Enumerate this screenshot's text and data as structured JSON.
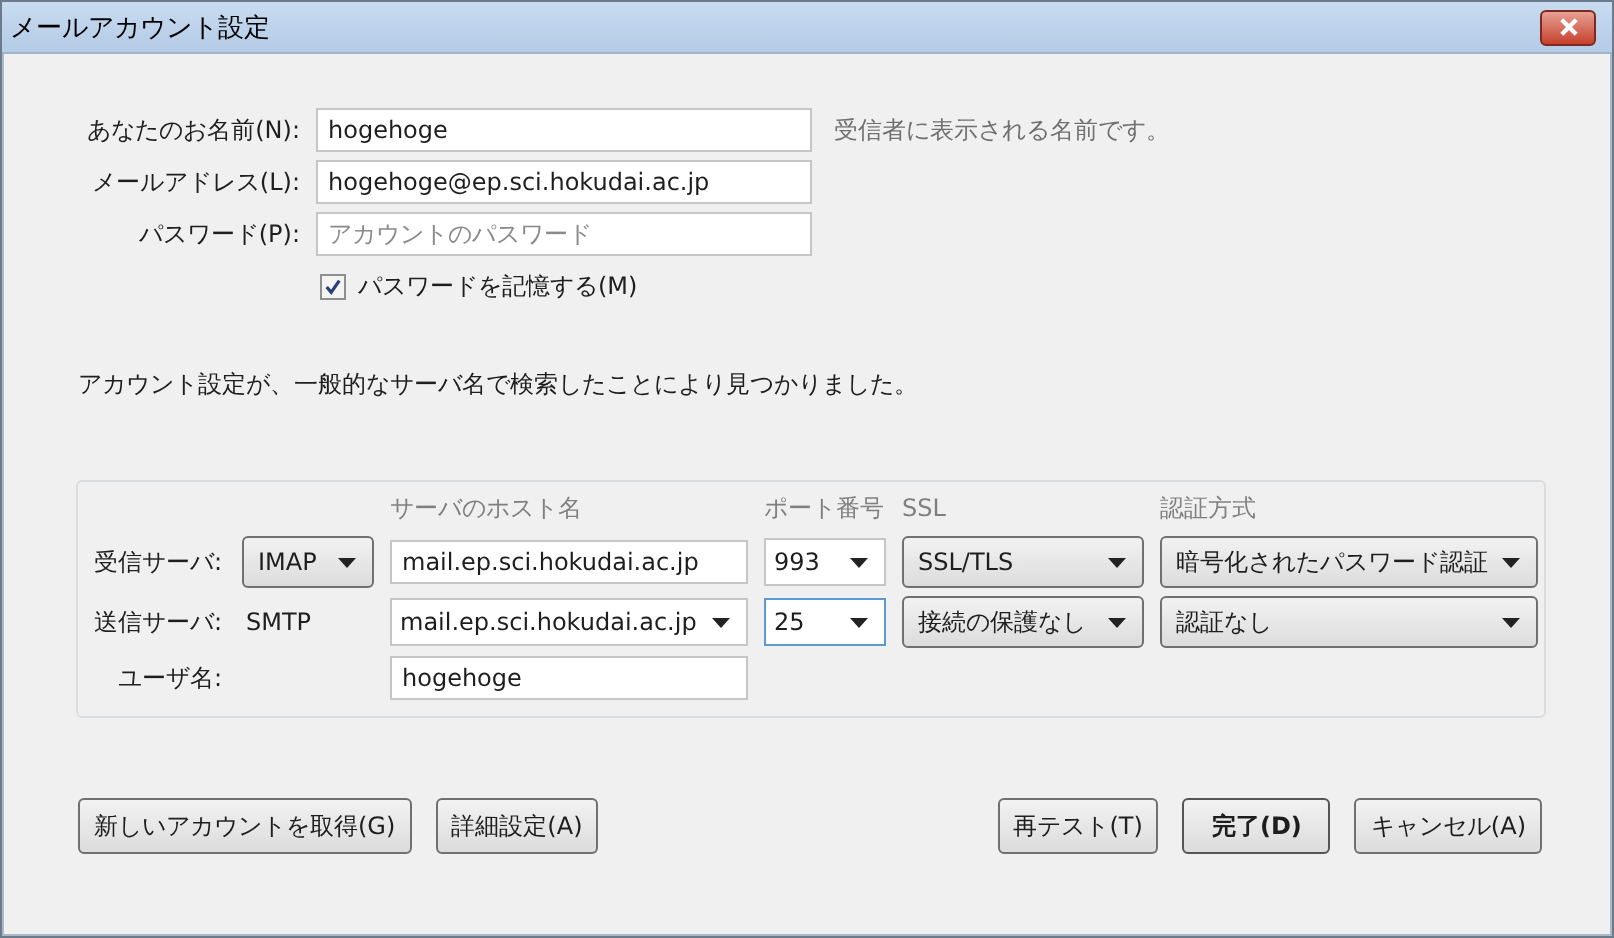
{
  "window": {
    "title": "メールアカウント設定"
  },
  "fields": [
    {
      "label": "あなたのお名前(N):",
      "value": "hogehoge",
      "hint": "受信者に表示される名前です。"
    },
    {
      "label": "メールアドレス(L):",
      "value": "hogehoge@ep.sci.hokudai.ac.jp"
    },
    {
      "label": "パスワード(P):",
      "placeholder": "アカウントのパスワード"
    }
  ],
  "remember_password": {
    "label": "パスワードを記憶する(M)",
    "checked": true
  },
  "status_message": "アカウント設定が、一般的なサーバ名で検索したことにより見つかりました。",
  "server_settings": {
    "columns": [
      "サーバのホスト名",
      "ポート番号",
      "SSL",
      "認証方式"
    ],
    "rows": [
      {
        "kind": "server",
        "label": "受信サーバ:",
        "protocol": {
          "kind": "dropdown",
          "text": "IMAP"
        },
        "host": {
          "kind": "text",
          "value": "mail.ep.sci.hokudai.ac.jp"
        },
        "port": {
          "value": "993",
          "focused": false
        },
        "ssl": "SSL/TLS",
        "auth": "暗号化されたパスワード認証"
      },
      {
        "kind": "server",
        "label": "送信サーバ:",
        "protocol": {
          "kind": "text",
          "text": "SMTP"
        },
        "host": {
          "kind": "combo",
          "value": "mail.ep.sci.hokudai.ac.jp"
        },
        "port": {
          "value": "25",
          "focused": true
        },
        "ssl": "接続の保護なし",
        "auth": "認証なし"
      },
      {
        "kind": "user",
        "label": "ユーザ名:",
        "host": {
          "kind": "text",
          "value": "hogehoge"
        }
      }
    ]
  },
  "buttons_left": [
    {
      "label": "新しいアカウントを取得(G)",
      "default": false
    },
    {
      "label": "詳細設定(A)",
      "default": false
    }
  ],
  "buttons_right": [
    {
      "label": "再テスト(T)",
      "default": false
    },
    {
      "label": "完了(D)",
      "default": true
    },
    {
      "label": "キャンセル(A)",
      "default": false
    }
  ]
}
